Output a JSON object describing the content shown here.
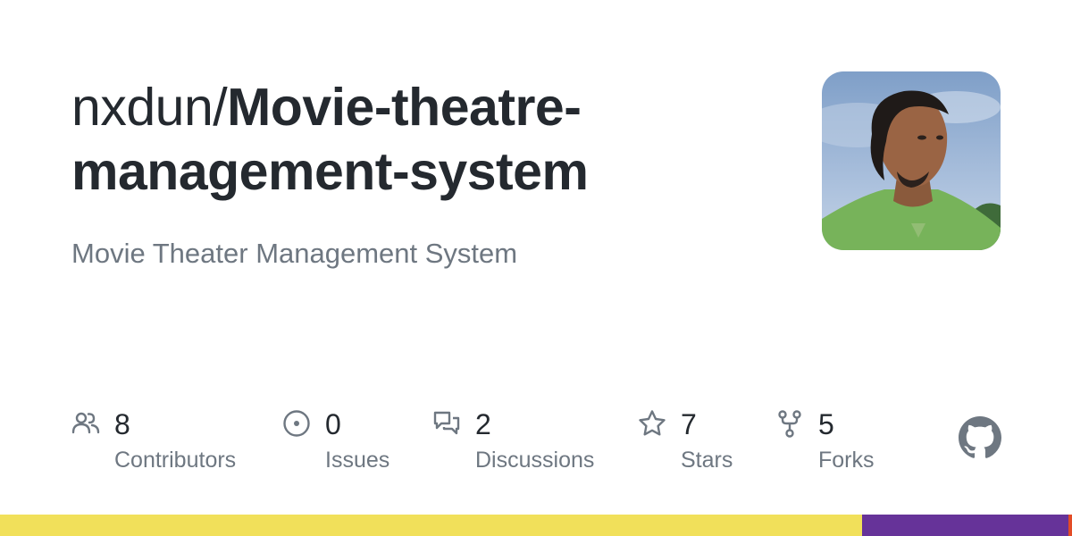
{
  "repo": {
    "owner": "nxdun/",
    "name": "Movie-theatre-management-system",
    "description": "Movie Theater Management System"
  },
  "stats": [
    {
      "icon": "contributors-icon",
      "count": "8",
      "label": "Contributors"
    },
    {
      "icon": "issues-icon",
      "count": "0",
      "label": "Issues"
    },
    {
      "icon": "discussions-icon",
      "count": "2",
      "label": "Discussions"
    },
    {
      "icon": "star-icon",
      "count": "7",
      "label": "Stars"
    },
    {
      "icon": "fork-icon",
      "count": "5",
      "label": "Forks"
    }
  ],
  "languages": [
    {
      "color": "#f1e05a",
      "share": 0.804
    },
    {
      "color": "#663399",
      "share": 0.193
    },
    {
      "color": "#e34c26",
      "share": 0.003
    }
  ],
  "colors": {
    "text": "#24292f",
    "muted": "#6e7781",
    "github_logo": "#6e7781"
  }
}
